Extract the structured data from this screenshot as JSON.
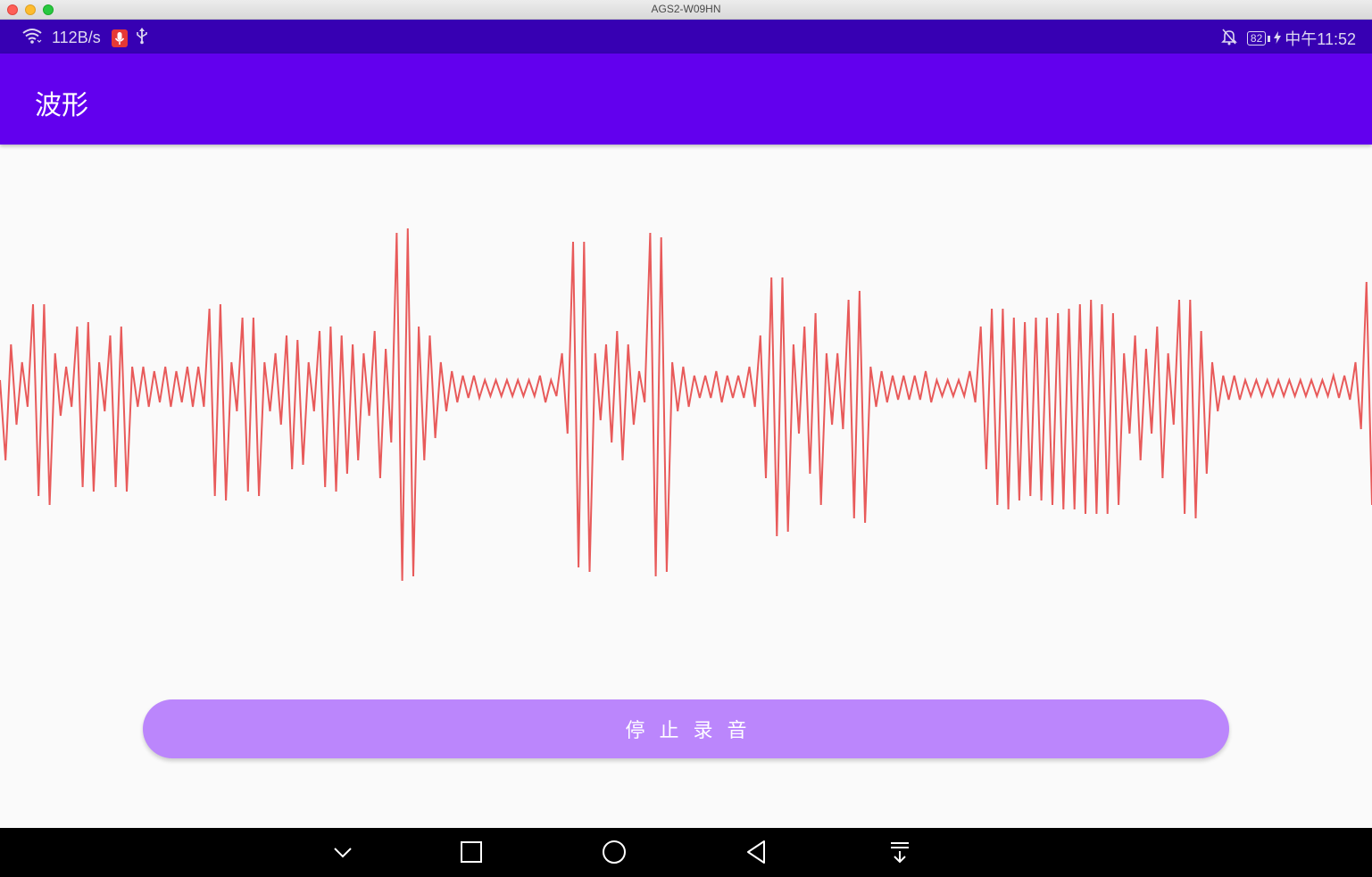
{
  "window": {
    "title": "AGS2-W09HN"
  },
  "status_bar": {
    "net_speed": "112B/s",
    "battery_level": "82",
    "time": "中午11:52",
    "icons": [
      "wifi-icon",
      "mic-icon",
      "usb-icon",
      "mute-bell-icon",
      "battery-icon",
      "charging-icon"
    ]
  },
  "app_bar": {
    "title": "波形"
  },
  "waveform": {
    "color": "#e85a5a",
    "samples": [
      10,
      -80,
      50,
      -40,
      30,
      -20,
      95,
      -120,
      95,
      -130,
      40,
      -30,
      25,
      -20,
      70,
      -110,
      75,
      -115,
      30,
      -25,
      60,
      -110,
      70,
      -115,
      25,
      -20,
      25,
      -20,
      20,
      -15,
      25,
      -20,
      20,
      -15,
      25,
      -20,
      25,
      -20,
      90,
      -120,
      95,
      -125,
      30,
      -25,
      80,
      -115,
      80,
      -120,
      30,
      -25,
      40,
      -40,
      60,
      -90,
      55,
      -85,
      30,
      -25,
      65,
      -110,
      70,
      -115,
      60,
      -95,
      50,
      -80,
      40,
      -30,
      65,
      -100,
      45,
      -60,
      175,
      -215,
      180,
      -210,
      70,
      -80,
      60,
      -55,
      30,
      -25,
      20,
      -15,
      15,
      -10,
      15,
      -10,
      10,
      -8,
      10,
      -8,
      10,
      -8,
      10,
      -8,
      10,
      -8,
      15,
      -15,
      10,
      -8,
      40,
      -50,
      165,
      -200,
      165,
      -205,
      40,
      -35,
      50,
      -60,
      65,
      -80,
      50,
      -40,
      20,
      -15,
      175,
      -210,
      170,
      -205,
      30,
      -25,
      25,
      -20,
      15,
      -10,
      15,
      -10,
      20,
      -15,
      15,
      -10,
      15,
      -10,
      25,
      -20,
      60,
      -100,
      125,
      -165,
      125,
      -160,
      50,
      -50,
      70,
      -95,
      85,
      -130,
      40,
      -40,
      40,
      -45,
      100,
      -145,
      110,
      -150,
      25,
      -20,
      20,
      -15,
      15,
      -12,
      15,
      -12,
      15,
      -12,
      20,
      -15,
      10,
      -8,
      10,
      -8,
      10,
      -8,
      20,
      -15,
      70,
      -90,
      90,
      -130,
      90,
      -135,
      80,
      -125,
      75,
      -120,
      80,
      -125,
      80,
      -130,
      85,
      -135,
      90,
      -135,
      95,
      -140,
      100,
      -140,
      95,
      -140,
      85,
      -130,
      40,
      -50,
      60,
      -80,
      45,
      -50,
      70,
      -100,
      40,
      -40,
      100,
      -140,
      100,
      -145,
      65,
      -95,
      30,
      -25,
      15,
      -12,
      15,
      -12,
      10,
      -8,
      10,
      -8,
      10,
      -8,
      10,
      -8,
      10,
      -8,
      10,
      -8,
      10,
      -8,
      10,
      -8,
      15,
      -10,
      15,
      -12,
      30,
      -45,
      120,
      -130
    ]
  },
  "actions": {
    "stop_recording_label": "停止录音"
  },
  "nav_bar": {
    "icons": [
      "collapse-chevron-icon",
      "recents-square-icon",
      "home-circle-icon",
      "back-triangle-icon",
      "notification-pulldown-icon"
    ]
  }
}
